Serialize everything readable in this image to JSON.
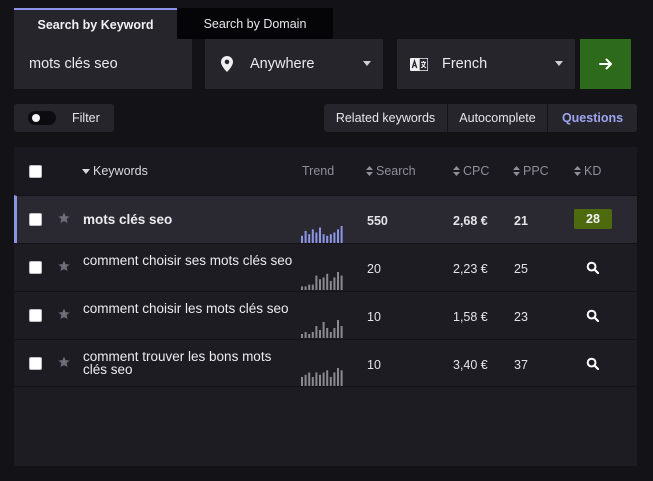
{
  "tabs": [
    {
      "label": "Search by Keyword"
    },
    {
      "label": "Search by Domain"
    }
  ],
  "search": {
    "keyword_value": "mots clés seo",
    "location": "Anywhere",
    "language": "French"
  },
  "filter": {
    "label": "Filter"
  },
  "segments": [
    "Related keywords",
    "Autocomplete",
    "Questions"
  ],
  "table": {
    "headers": {
      "keywords": "Keywords",
      "trend": "Trend",
      "search": "Search",
      "cpc": "CPC",
      "ppc": "PPC",
      "kd": "KD"
    },
    "rows": [
      {
        "keyword": "mots clés seo",
        "search": "550",
        "cpc": "2,68 €",
        "ppc": "21",
        "kd": "28",
        "trend": [
          5,
          8,
          6,
          9,
          7,
          10,
          6,
          5,
          6,
          7,
          9,
          11
        ],
        "trend_color": "#8c94e6"
      },
      {
        "keyword": "comment choisir ses mots clés seo",
        "search": "20",
        "cpc": "2,23 €",
        "ppc": "25",
        "kd": "",
        "trend": [
          2,
          2,
          3,
          3,
          8,
          6,
          7,
          9,
          5,
          7,
          10,
          8
        ],
        "trend_color": "#8a8990"
      },
      {
        "keyword": "comment choisir les mots clés seo",
        "search": "10",
        "cpc": "1,58 €",
        "ppc": "23",
        "kd": "",
        "trend": [
          2,
          3,
          2,
          3,
          6,
          4,
          8,
          5,
          3,
          5,
          9,
          6
        ],
        "trend_color": "#8a8990"
      },
      {
        "keyword": "comment trouver les bons mots clés seo",
        "search": "10",
        "cpc": "3,40 €",
        "ppc": "37",
        "kd": "",
        "trend": [
          4,
          5,
          6,
          4,
          6,
          5,
          6,
          7,
          4,
          6,
          8,
          7
        ],
        "trend_color": "#8a8990"
      }
    ]
  },
  "colors": {
    "accent": "#8c94e6",
    "go_button": "#2e6a1c",
    "kd_badge": "#4e6a0f",
    "background": "#131217",
    "panel": "#26252c"
  },
  "icons": {
    "location": "map-pin-icon",
    "language": "translate-icon",
    "go": "arrow-right-icon",
    "star": "star-icon",
    "kd_search": "magnifier-icon",
    "sort": "sort-icon"
  }
}
